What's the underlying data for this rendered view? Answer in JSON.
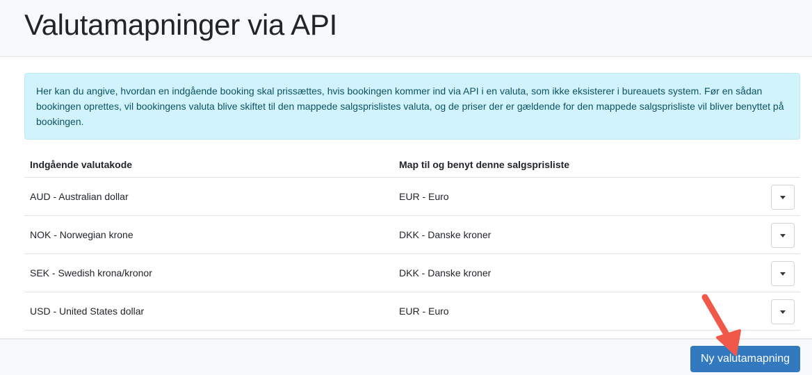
{
  "header": {
    "title": "Valutamapninger via API"
  },
  "info": {
    "text": "Her kan du angive, hvordan en indgående booking skal prissættes, hvis bookingen kommer ind via API i en valuta, som ikke eksisterer i bureauets system. Før en sådan bookingen oprettes, vil bookingens valuta blive skiftet til den mappede salgsprislistes valuta, og de priser der er gældende for den mappede salgsprisliste vil bliver benyttet på bookingen."
  },
  "table": {
    "headers": [
      "Indgående valutakode",
      "Map til og benyt denne salgsprisliste"
    ],
    "rows": [
      {
        "incoming": "AUD - Australian dollar",
        "mapped": "EUR - Euro"
      },
      {
        "incoming": "NOK - Norwegian krone",
        "mapped": "DKK - Danske kroner"
      },
      {
        "incoming": "SEK - Swedish krona/kronor",
        "mapped": "DKK - Danske kroner"
      },
      {
        "incoming": "USD - United States dollar",
        "mapped": "EUR - Euro"
      }
    ]
  },
  "footer": {
    "new_button_label": "Ny valutamapning"
  },
  "colors": {
    "primary": "#3279c0",
    "info_bg": "#d1f4fc",
    "annotation_arrow": "#f0594a"
  },
  "icons": {
    "row_menu": "caret-down-icon",
    "annotation": "arrow-down-right-icon"
  }
}
